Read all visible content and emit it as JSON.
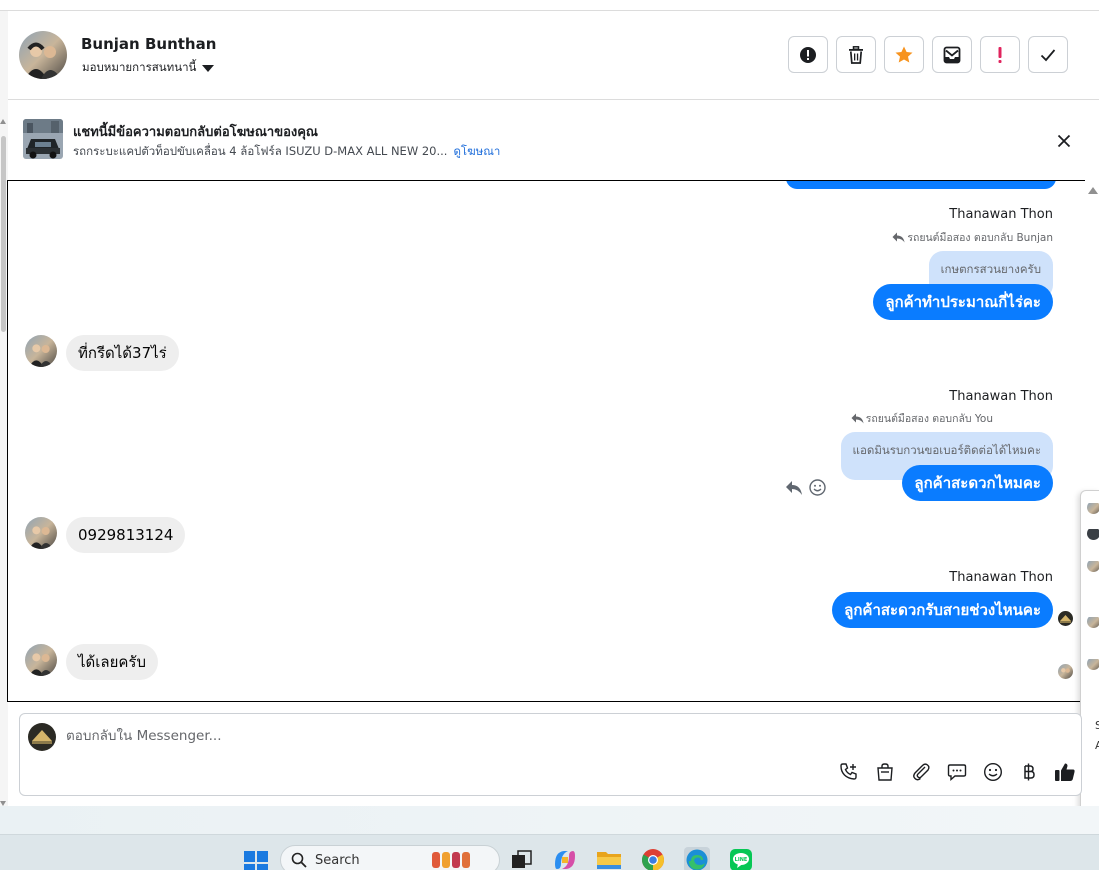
{
  "header": {
    "name": "Bunjan Bunthan",
    "assign_label": "มอบหมายการสนทนานี้"
  },
  "header_actions": [
    {
      "icon": "alert-circle-icon"
    },
    {
      "icon": "trash-icon"
    },
    {
      "icon": "star-icon",
      "color": "#f7931e"
    },
    {
      "icon": "mail-archive-icon"
    },
    {
      "icon": "exclamation-icon",
      "color": "#e0245e"
    },
    {
      "icon": "check-icon"
    }
  ],
  "ad": {
    "title": "แชทนี้มีข้อความตอบกลับต่อโฆษณาของคุณ",
    "description": "รถกระบะแคปตัวท็อปขับเคลื่อน 4 ล้อโฟร์ล ISUZU D-MAX ALL NEW 20...",
    "link": "ดูโฆษณา"
  },
  "messages": {
    "m1": {
      "sender": "Thanawan Thon",
      "reply_note": "รถยนต์มือสอง ตอบกลับ Bunjan",
      "quoted": "เกษตกรสวนยางครับ",
      "text": "ลูกค้าทำประมาณกี่ไร่คะ"
    },
    "m2": {
      "text": "ที่กรีดได้37ไร่"
    },
    "m3": {
      "sender": "Thanawan Thon",
      "reply_note": "รถยนต์มือสอง ตอบกลับ You",
      "quoted": "แอดมินรบกวนขอเบอร์ติดต่อได้ไหมคะ",
      "text": "ลูกค้าสะดวกไหมคะ"
    },
    "m4": {
      "text": "0929813124"
    },
    "m5": {
      "sender": "Thanawan Thon",
      "text": "ลูกค้าสะดวกรับสายช่วงไหนคะ"
    },
    "m6": {
      "text": "ได้เลยครับ"
    }
  },
  "composer": {
    "placeholder": "ตอบกลับใน Messenger...",
    "tools": [
      "phone-plus-icon",
      "shopping-bag-icon",
      "paperclip-icon",
      "chat-bubble-icon",
      "emoji-icon",
      "baht-icon",
      "thumbs-up-icon"
    ]
  },
  "side_panel": {
    "fragments": [
      "S",
      "A"
    ]
  },
  "taskbar": {
    "search_label": "Search",
    "apps": [
      "task-view-icon",
      "copilot-icon",
      "file-explorer-icon",
      "chrome-icon",
      "edge-icon",
      "line-icon"
    ]
  },
  "colors": {
    "messenger_blue": "#0a7cff",
    "incoming_gray": "#eeeeee",
    "quote_blue": "#cfe2fb",
    "link_blue": "#216fdb"
  }
}
